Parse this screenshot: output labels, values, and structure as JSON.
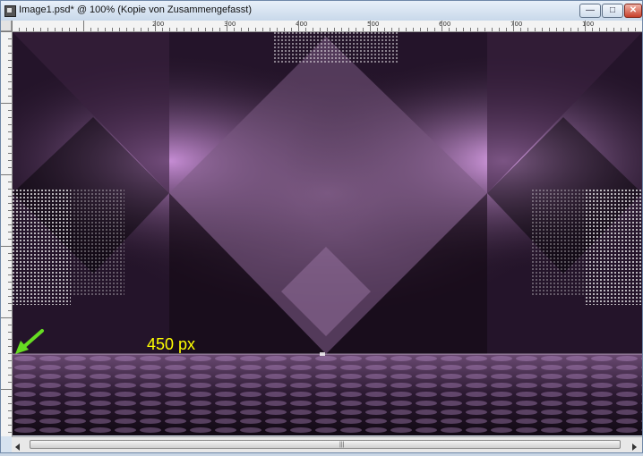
{
  "window": {
    "title": "Image1.psd* @ 100% (Kopie von Zusammengefasst)",
    "controls": {
      "minimize": "—",
      "maximize": "□",
      "close": "✕"
    }
  },
  "ruler_top": {
    "labels": [
      "100",
      "200",
      "300",
      "400",
      "500",
      "600",
      "700"
    ]
  },
  "ruler_left": {
    "labels": [
      "100",
      "200",
      "300",
      "400"
    ]
  },
  "canvas": {
    "annotation_text": "450 px",
    "annotation_color": "#ffff00",
    "arrow_color": "#66dd22",
    "accent_purple": "#c07ad0"
  },
  "scrollbar": {
    "left_arrow": "◀",
    "right_arrow": "▶",
    "grip": "|||"
  }
}
